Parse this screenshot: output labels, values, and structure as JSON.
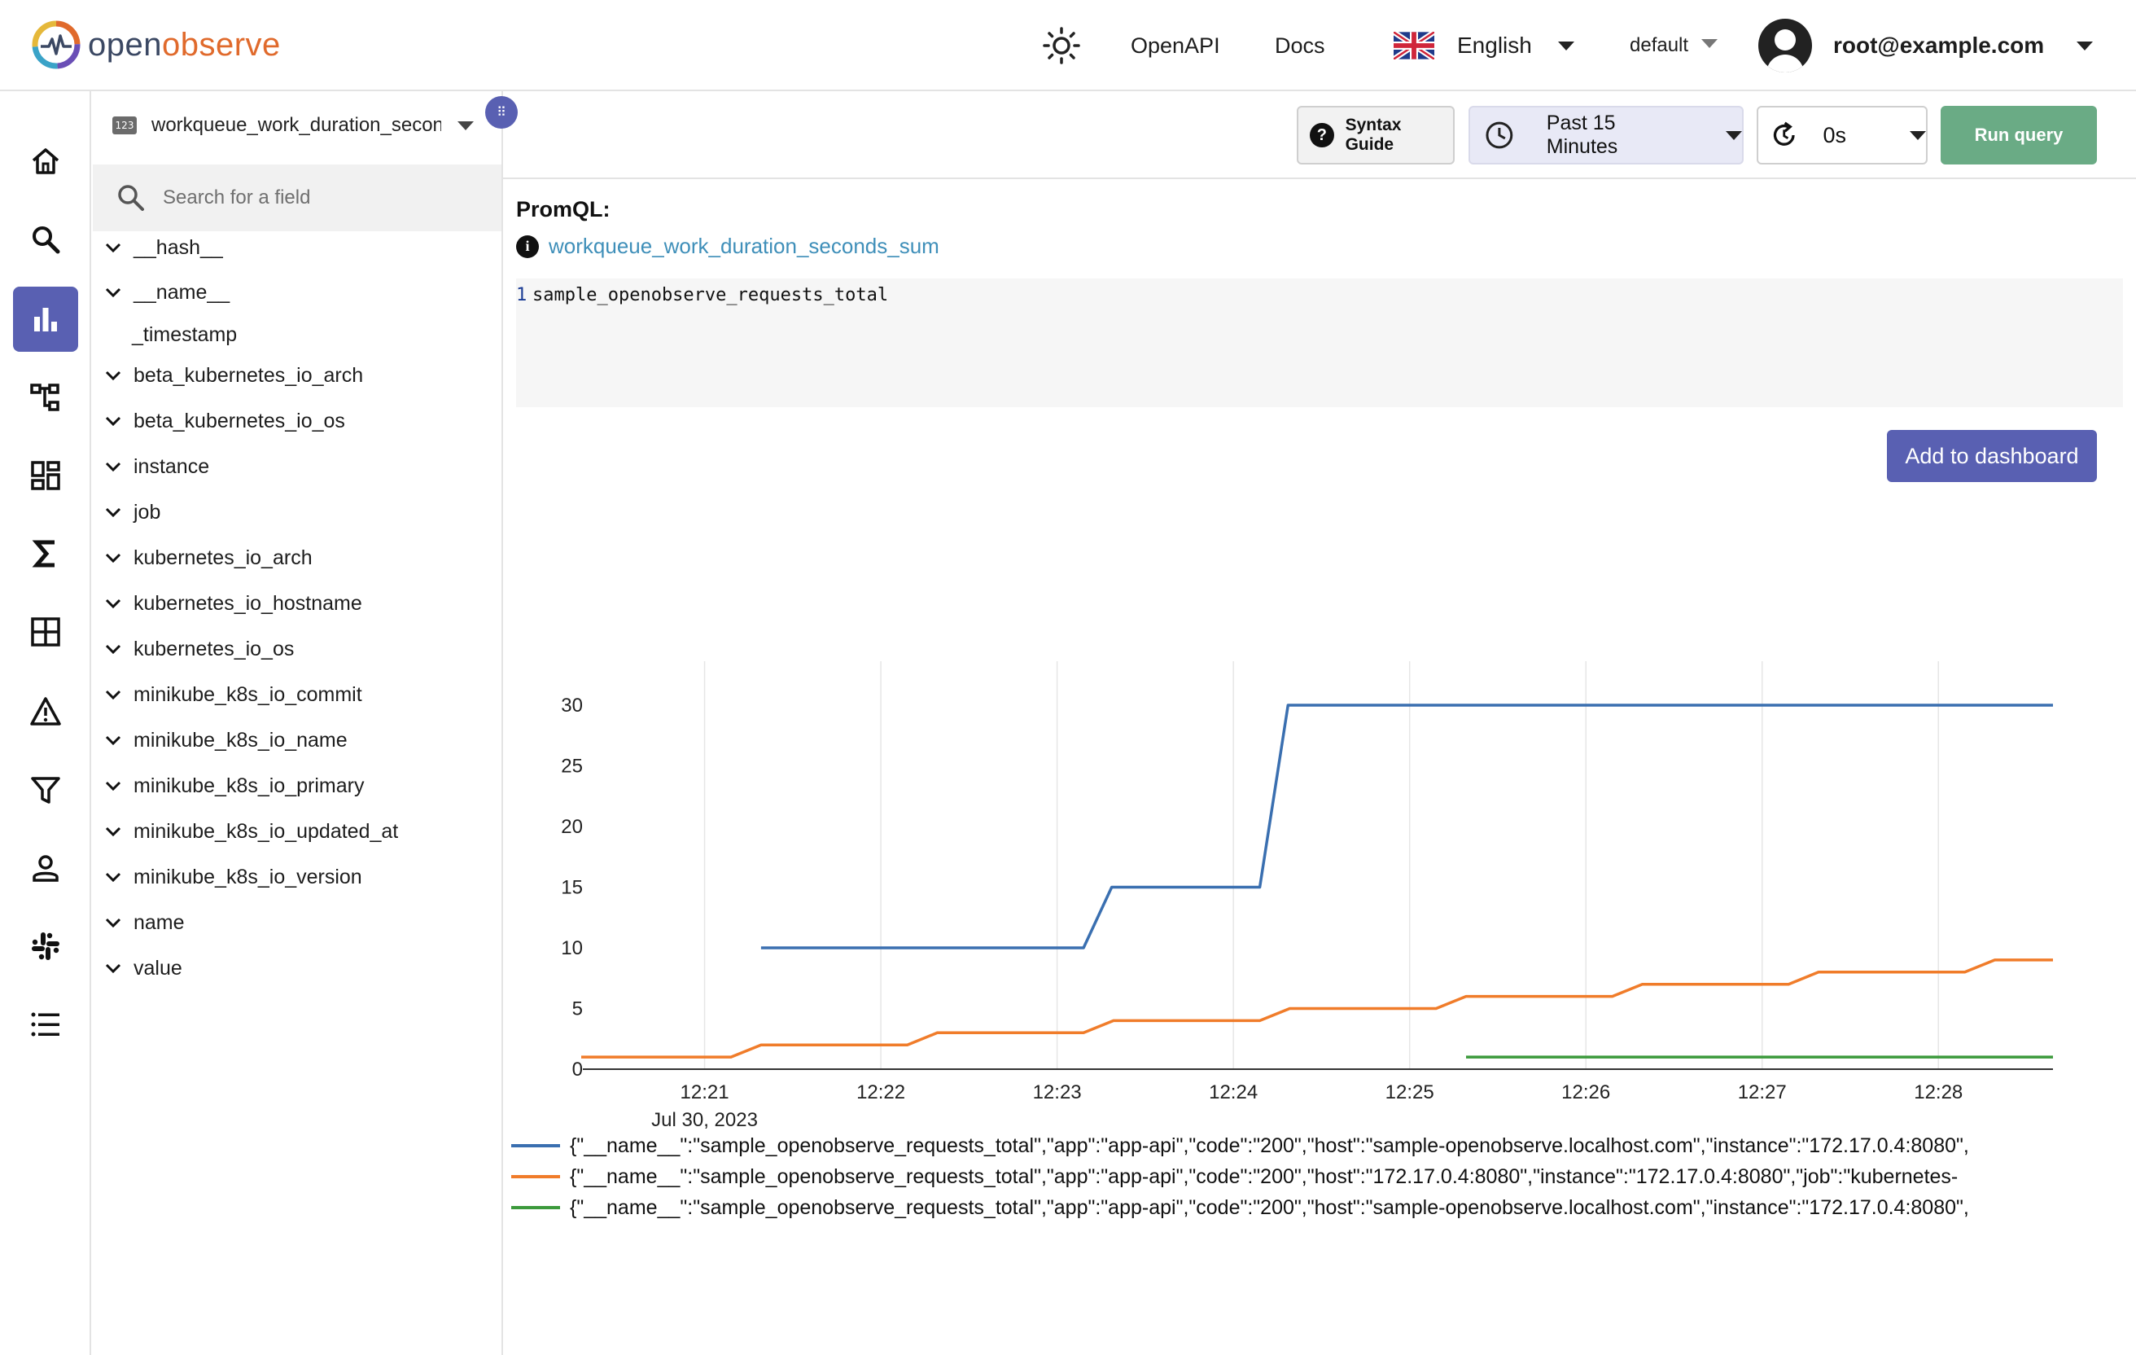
{
  "app": {
    "logo_part1": "open",
    "logo_part2": "observe"
  },
  "header": {
    "theme_icon": "sun-icon",
    "openapi_label": "OpenAPI",
    "docs_label": "Docs",
    "language": "English",
    "org": "default",
    "user": "root@example.com"
  },
  "nav": {
    "items": [
      {
        "icon": "home-icon"
      },
      {
        "icon": "search-icon"
      },
      {
        "icon": "metrics-icon",
        "active": true
      },
      {
        "icon": "traces-icon"
      },
      {
        "icon": "dashboards-icon"
      },
      {
        "icon": "functions-icon"
      },
      {
        "icon": "streams-icon"
      },
      {
        "icon": "alerts-icon"
      },
      {
        "icon": "ingestion-icon"
      },
      {
        "icon": "users-icon"
      },
      {
        "icon": "slack-icon"
      },
      {
        "icon": "about-icon"
      }
    ]
  },
  "fields_panel": {
    "stream_badge": "123",
    "stream_name": "workqueue_work_duration_seconds_sum",
    "search_placeholder": "Search for a field",
    "fields": [
      {
        "name": "__hash__",
        "expandable": true
      },
      {
        "name": "__name__",
        "expandable": true
      },
      {
        "name": "_timestamp",
        "expandable": false
      },
      {
        "name": "beta_kubernetes_io_arch",
        "expandable": true
      },
      {
        "name": "beta_kubernetes_io_os",
        "expandable": true
      },
      {
        "name": "instance",
        "expandable": true
      },
      {
        "name": "job",
        "expandable": true
      },
      {
        "name": "kubernetes_io_arch",
        "expandable": true
      },
      {
        "name": "kubernetes_io_hostname",
        "expandable": true
      },
      {
        "name": "kubernetes_io_os",
        "expandable": true
      },
      {
        "name": "minikube_k8s_io_commit",
        "expandable": true
      },
      {
        "name": "minikube_k8s_io_name",
        "expandable": true
      },
      {
        "name": "minikube_k8s_io_primary",
        "expandable": true
      },
      {
        "name": "minikube_k8s_io_updated_at",
        "expandable": true
      },
      {
        "name": "minikube_k8s_io_version",
        "expandable": true
      },
      {
        "name": "name",
        "expandable": true
      },
      {
        "name": "value",
        "expandable": true
      }
    ]
  },
  "toolbar": {
    "syntax_guide": "Syntax Guide",
    "time_range": "Past 15 Minutes",
    "refresh": "0s",
    "run_query": "Run query"
  },
  "query": {
    "label": "PromQL:",
    "metric_link": "workqueue_work_duration_seconds_sum",
    "line_number": "1",
    "code": "sample_openobserve_requests_total",
    "add_to_dashboard": "Add to dashboard"
  },
  "chart_data": {
    "type": "line",
    "step": true,
    "ylim": [
      0,
      30
    ],
    "yticks": [
      0,
      5,
      10,
      15,
      20,
      25,
      30
    ],
    "xticks": [
      "12:21",
      "12:22",
      "12:23",
      "12:24",
      "12:25",
      "12:26",
      "12:27",
      "12:28"
    ],
    "date_label": "Jul 30, 2023",
    "xlim": [
      "12:20.30",
      "12:28.65"
    ],
    "grid": true,
    "legend_position": "bottom",
    "series": [
      {
        "name": "{\"__name__\":\"sample_openobserve_requests_total\",\"app\":\"app-api\",\"code\":\"200\",\"host\":\"sample-openobserve.localhost.com\",\"instance\":\"172.17.0.4:8080\",",
        "color": "#3a6fb0",
        "x": [
          21.32,
          22.15,
          23.15,
          23.31,
          24.15,
          24.31,
          28.65
        ],
        "y": [
          10,
          10,
          10,
          15,
          15,
          30,
          30
        ]
      },
      {
        "name": "{\"__name__\":\"sample_openobserve_requests_total\",\"app\":\"app-api\",\"code\":\"200\",\"host\":\"172.17.0.4:8080\",\"instance\":\"172.17.0.4:8080\",\"job\":\"kubernetes-",
        "color": "#f07c2a",
        "x": [
          20.3,
          20.45,
          20.62,
          20.77,
          21.15,
          21.32,
          21.62,
          21.77,
          22.15,
          22.32,
          22.62,
          22.77,
          23.15,
          23.32,
          23.62,
          23.77,
          24.15,
          24.32,
          24.62,
          24.77,
          25.15,
          25.32,
          25.62,
          25.77,
          26.15,
          26.32,
          26.62,
          26.77,
          27.15,
          27.32,
          27.62,
          27.77,
          28.15,
          28.32,
          28.65
        ],
        "y": [
          1,
          1,
          1,
          1,
          1,
          2,
          2,
          2,
          2,
          3,
          3,
          3,
          3,
          4,
          4,
          4,
          4,
          5,
          5,
          5,
          5,
          6,
          6,
          6,
          6,
          7,
          7,
          7,
          7,
          8,
          8,
          8,
          8,
          9,
          9
        ]
      },
      {
        "name": "{\"__name__\":\"sample_openobserve_requests_total\",\"app\":\"app-api\",\"code\":\"200\",\"host\":\"sample-openobserve.localhost.com\",\"instance\":\"172.17.0.4:8080\",",
        "color": "#3c9a3c",
        "x": [
          25.32,
          28.65
        ],
        "y": [
          1,
          1
        ]
      }
    ]
  }
}
